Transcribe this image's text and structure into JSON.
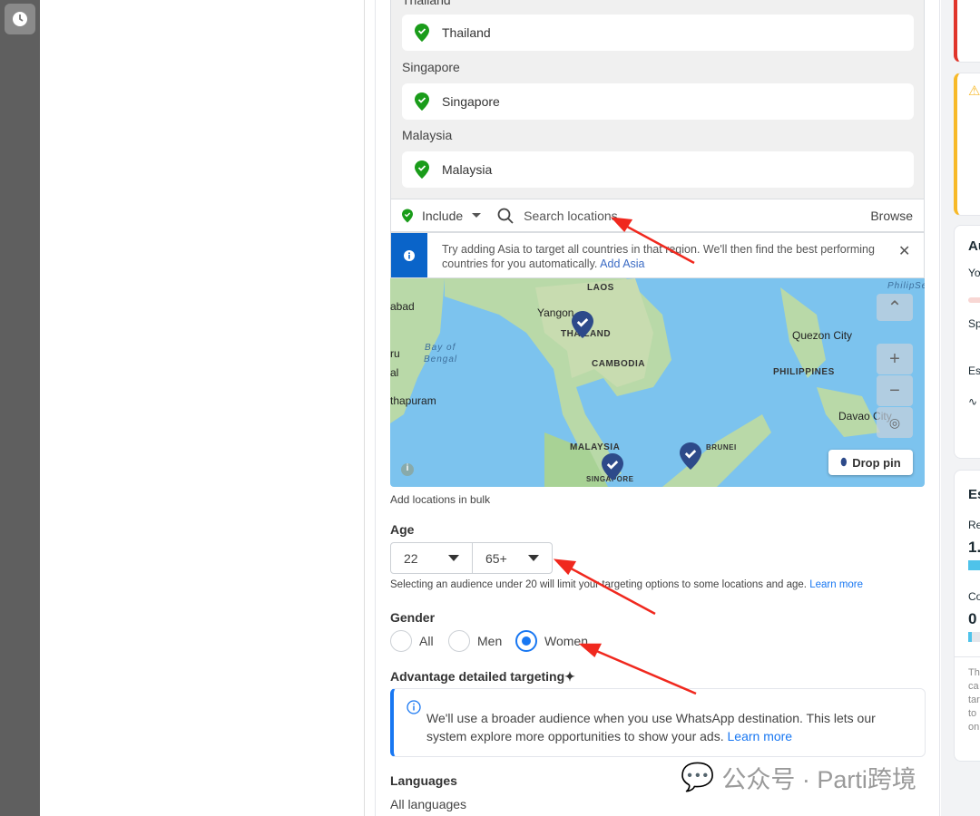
{
  "locations": {
    "groups": [
      {
        "label": "Thailand",
        "item": "Thailand"
      },
      {
        "label": "Singapore",
        "item": "Singapore"
      },
      {
        "label": "Malaysia",
        "item": "Malaysia"
      }
    ],
    "include_label": "Include",
    "search_placeholder": "Search locations",
    "browse_label": "Browse",
    "info_text": "Try adding Asia to target all countries in that region. We'll then find the best performing countries for you automatically.",
    "info_link": "Add Asia",
    "add_bulk": "Add locations in bulk",
    "drop_pin": "Drop pin"
  },
  "map": {
    "labels": {
      "abad": "abad",
      "yangon": "Yangon",
      "laos": "LAOS",
      "thailand": "THAILAND",
      "cambodia": "CAMBODIA",
      "bay": "Bay of",
      "bengal": "Bengal",
      "ru": "ru",
      "al": "al",
      "thapuram": "thapuram",
      "quezon": "Quezon City",
      "philippines": "PHILIPPINES",
      "davao": "Davao City",
      "malaysia": "MALAYSIA",
      "singapore": "SINGAPORE",
      "brunei": "BRUNEI",
      "philip": "Philip",
      "se": "Se"
    }
  },
  "age": {
    "label": "Age",
    "min": "22",
    "max": "65+",
    "note": "Selecting an audience under 20 will limit your targeting options to some locations and age.",
    "learn_more": "Learn more"
  },
  "gender": {
    "label": "Gender",
    "options": [
      "All",
      "Men",
      "Women"
    ],
    "selected": "Women"
  },
  "advantage": {
    "label": "Advantage detailed targeting",
    "text": "We'll use a broader audience when you use WhatsApp destination. This lets our system explore more opportunities to show your ads.",
    "learn_more": "Learn more"
  },
  "languages": {
    "label": "Languages",
    "value": "All languages"
  },
  "right_cards": {
    "audience_title": "Au",
    "audience_line1": "Yo",
    "audience_line2": "Sp",
    "audience_line3": "Es",
    "est_title": "Es",
    "reach_label": "Re",
    "reach_value": "1.",
    "conv_label": "Co",
    "conv_value": "0",
    "footer": [
      "Th",
      "ca",
      "tar",
      "to",
      "on"
    ]
  },
  "watermark": "公众号 · Parti跨境",
  "colors": {
    "accent": "#1877f2",
    "pin_green": "#1a9c1a",
    "info_blue": "#0a64c9",
    "error": "#e0352b",
    "warning": "#f7b928"
  }
}
